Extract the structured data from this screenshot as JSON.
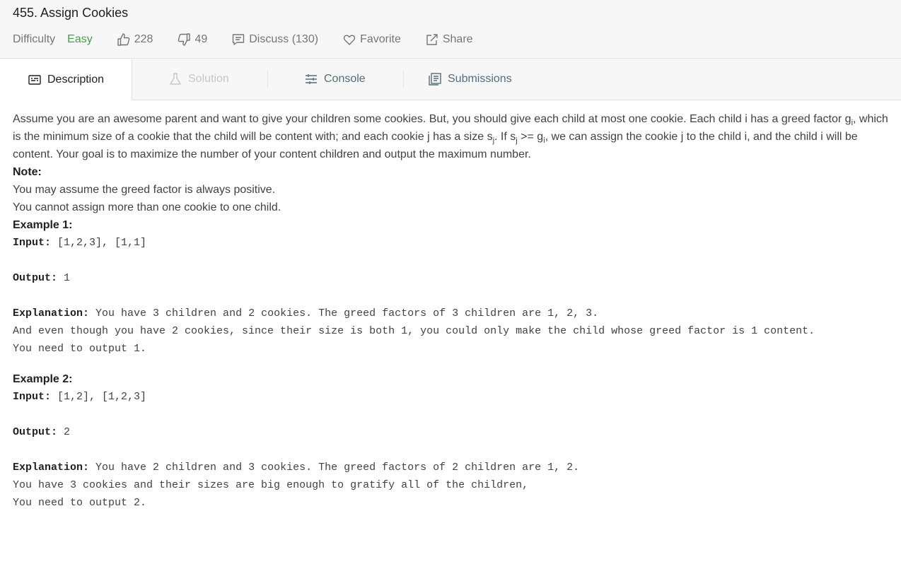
{
  "problem": {
    "title": "455.  Assign Cookies",
    "difficulty_label": "Difficulty",
    "difficulty": "Easy",
    "likes": "228",
    "dislikes": "49",
    "discuss": "Discuss (130)",
    "favorite": "Favorite",
    "share": "Share"
  },
  "tabs": {
    "description": "Description",
    "solution": "Solution",
    "console": "Console",
    "submissions": "Submissions"
  },
  "description": {
    "s1": "Assume you are an awesome parent and want to give your children some cookies. But, you should give each child at most one cookie. Each child i has a greed factor g",
    "sub_i": "i",
    "s2": ", which is the minimum size of a cookie that the child will be content with; and each cookie j has a size s",
    "sub_j": "j",
    "s3": ". If s",
    "s4": " >= g",
    "s5": ", we can assign the cookie j to the child i, and the child i will be content. Your goal is to maximize the number of your content children and output the maximum number."
  },
  "note": {
    "title": "Note:",
    "line1": "You may assume the greed factor is always positive.",
    "line2": "You cannot assign more than one cookie to one child."
  },
  "example1": {
    "title": "Example 1:",
    "input_label": "Input:",
    "input": " [1,2,3], [1,1]",
    "output_label": "Output:",
    "output": " 1",
    "explanation_label": "Explanation:",
    "explanation": " You have 3 children and 2 cookies. The greed factors of 3 children are 1, 2, 3. \nAnd even though you have 2 cookies, since their size is both 1, you could only make the child whose greed factor is 1 content.\nYou need to output 1."
  },
  "example2": {
    "title": "Example 2:",
    "input_label": "Input:",
    "input": " [1,2], [1,2,3]",
    "output_label": "Output:",
    "output": " 2",
    "explanation_label": "Explanation:",
    "explanation": " You have 2 children and 3 cookies. The greed factors of 2 children are 1, 2. \nYou have 3 cookies and their sizes are big enough to gratify all of the children, \nYou need to output 2."
  },
  "colors": {
    "easy": "#43a047",
    "header_bg": "#f7f7f7",
    "text": "#424242",
    "meta": "#757575"
  },
  "icons": [
    "thumbs-up-icon",
    "thumbs-down-icon",
    "discuss-icon",
    "heart-icon",
    "share-icon",
    "description-icon",
    "flask-icon",
    "console-sliders-icon",
    "submissions-icon"
  ]
}
